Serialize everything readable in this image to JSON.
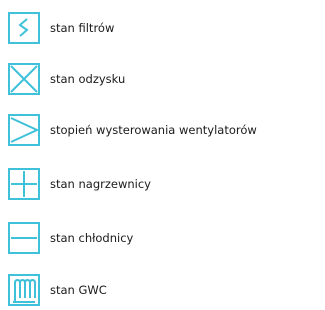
{
  "colors": {
    "icon_border": "#3fc1d9",
    "icon_fill": "#ffffff",
    "text": "#1a1a1a"
  },
  "legend": {
    "items": [
      {
        "icon": "filter-icon",
        "label": "stan filtrów"
      },
      {
        "icon": "recovery-icon",
        "label": "stan odzysku"
      },
      {
        "icon": "fan-level-icon",
        "label": "stopień wysterowania wentylatorów"
      },
      {
        "icon": "heater-icon",
        "label": "stan nagrzewnicy"
      },
      {
        "icon": "cooler-icon",
        "label": "stan chłodnicy"
      },
      {
        "icon": "gwc-icon",
        "label": "stan GWC"
      }
    ]
  }
}
